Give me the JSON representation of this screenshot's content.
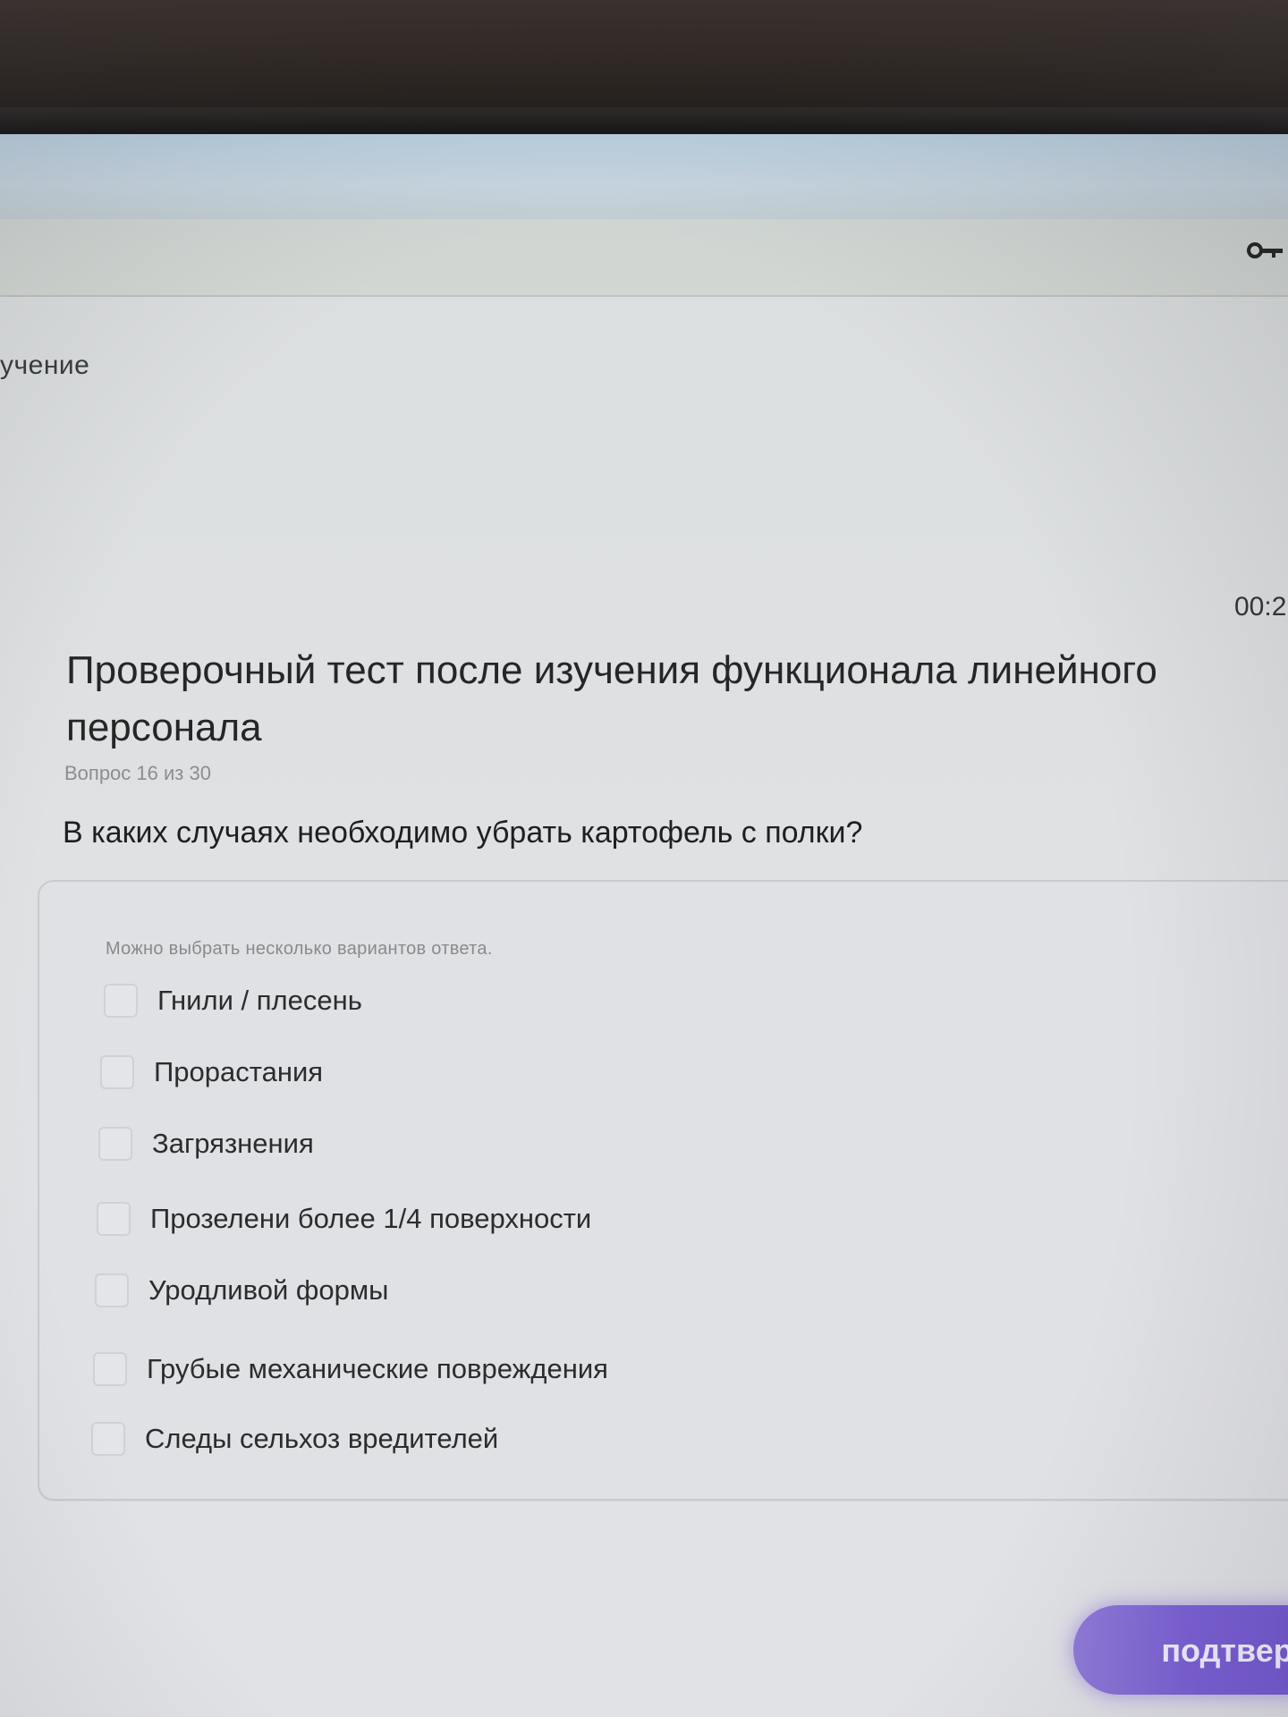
{
  "breadcrumb": {
    "partial_label": "учение"
  },
  "timer": {
    "value": "00:2"
  },
  "test": {
    "title": "Проверочный тест после изучения функционала линейного персонала",
    "question_counter": "Вопрос 16 из 30",
    "question_text": "В каких случаях необходимо убрать картофель с полки?",
    "hint": "Можно выбрать несколько вариантов ответа.",
    "options": [
      {
        "label": "Гнили / плесень",
        "checked": false
      },
      {
        "label": "Прорастания",
        "checked": false
      },
      {
        "label": "Загрязнения",
        "checked": false
      },
      {
        "label": "Прозелени более 1/4 поверхности",
        "checked": false
      },
      {
        "label": "Уродливой формы",
        "checked": false
      },
      {
        "label": "Грубые механические повреждения",
        "checked": false
      },
      {
        "label": "Следы сельхоз вредителей",
        "checked": false
      }
    ]
  },
  "actions": {
    "submit_label": "подтверд"
  },
  "colors": {
    "accent": "#7b5fd6",
    "page_background": "#dfe1e3"
  },
  "icons": {
    "toolbar_icon": "key-icon"
  }
}
